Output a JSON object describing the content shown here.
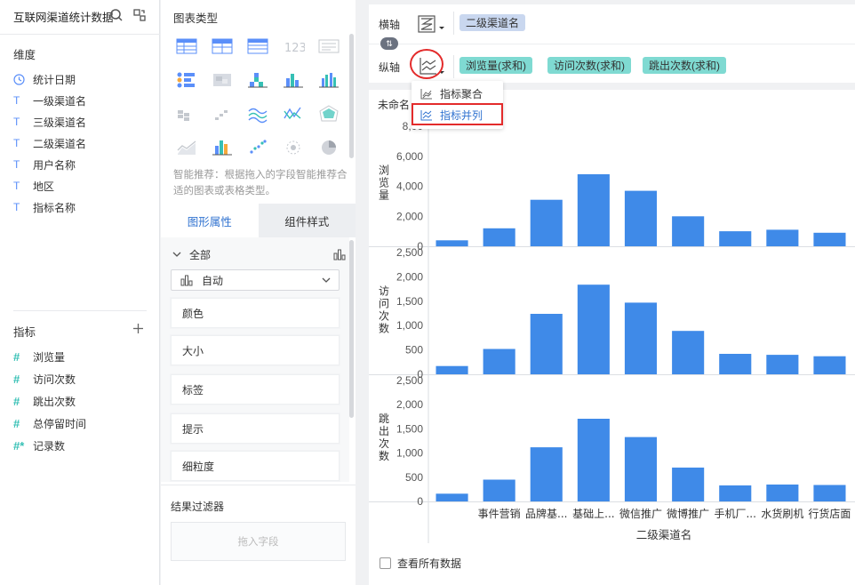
{
  "left_panel": {
    "title": "互联网渠道统计数据",
    "dimensions_label": "维度",
    "dimensions": [
      {
        "icon": "clock-icon",
        "label": "统计日期"
      },
      {
        "icon": "text-type-icon",
        "label": "一级渠道名"
      },
      {
        "icon": "text-type-icon",
        "label": "三级渠道名"
      },
      {
        "icon": "text-type-icon",
        "label": "二级渠道名"
      },
      {
        "icon": "text-type-icon",
        "label": "用户名称"
      },
      {
        "icon": "text-type-icon",
        "label": "地区"
      },
      {
        "icon": "text-type-icon",
        "label": "指标名称"
      }
    ],
    "metrics_label": "指标",
    "metrics": [
      {
        "icon": "hash-icon",
        "label": "浏览量"
      },
      {
        "icon": "hash-icon",
        "label": "访问次数"
      },
      {
        "icon": "hash-icon",
        "label": "跳出次数"
      },
      {
        "icon": "hash-icon",
        "label": "总停留时间"
      },
      {
        "icon": "hash-star-icon",
        "label": "记录数"
      }
    ]
  },
  "middle_panel": {
    "chart_type_title": "图表类型",
    "recommend_hint": "智能推荐：根据拖入的字段智能推荐合适的图表或表格类型。",
    "tabs": [
      "图形属性",
      "组件样式"
    ],
    "all_label": "全部",
    "chart_select_value": "自动",
    "properties": [
      "颜色",
      "大小",
      "标签",
      "提示",
      "细粒度"
    ],
    "filter_title": "结果过滤器",
    "filter_drop_placeholder": "拖入字段"
  },
  "axis_bar": {
    "x_axis_label": "横轴",
    "x_fields": [
      "二级渠道名"
    ],
    "y_axis_label": "纵轴",
    "y_fields": [
      "浏览量(求和)",
      "访问次数(求和)",
      "跳出次数(求和)"
    ]
  },
  "popup_menu": {
    "items": [
      "指标聚合",
      "指标并列"
    ],
    "selected_index": 1
  },
  "chart_card": {
    "name": "未命名",
    "show_all_label": "查看所有数据"
  },
  "colors": {
    "bar": "#3f8ae8",
    "accent": "#3173d0",
    "highlight": "#e32b2b",
    "pill_teal": "#7fdad2",
    "pill_blue": "#c9d7ef"
  },
  "chart_data": {
    "type": "bar",
    "x_title": "二级渠道名",
    "categories": [
      "",
      "事件营销",
      "品牌基...",
      "基础上...",
      "微信推广",
      "微博推广",
      "手机厂...",
      "水货刷机",
      "行货店面"
    ],
    "panels": [
      {
        "name": "浏览量",
        "ylabel": "浏览量",
        "ylim": [
          0,
          8000
        ],
        "ticks": [
          "0",
          "2,000",
          "4,000",
          "6,000",
          "8,00"
        ],
        "values": [
          400,
          1200,
          3100,
          4800,
          3700,
          2000,
          1000,
          1100,
          900
        ]
      },
      {
        "name": "访问次数",
        "ylabel": "访问次数",
        "ylim": [
          0,
          2500
        ],
        "ticks": [
          "0",
          "500",
          "1,000",
          "1,500",
          "2,000",
          "2,500"
        ],
        "values": [
          170,
          520,
          1240,
          1840,
          1470,
          890,
          420,
          400,
          370
        ]
      },
      {
        "name": "跳出次数",
        "ylabel": "跳出次数",
        "ylim": [
          0,
          2500
        ],
        "ticks": [
          "0",
          "500",
          "1,000",
          "1,500",
          "2,000",
          "2,500"
        ],
        "values": [
          160,
          450,
          1120,
          1710,
          1330,
          700,
          330,
          350,
          340
        ]
      }
    ]
  }
}
